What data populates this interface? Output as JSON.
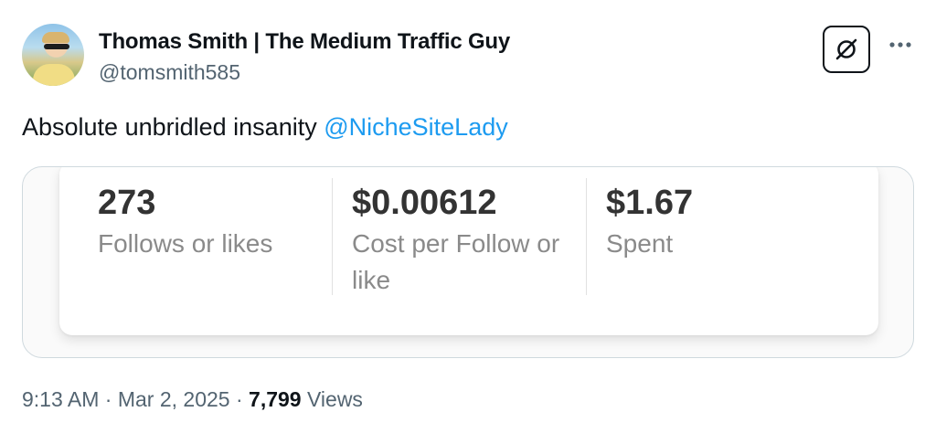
{
  "author": {
    "display_name": "Thomas Smith | The Medium Traffic Guy",
    "handle": "@tomsmith585",
    "avatar_icon": "profile-photo"
  },
  "actions": {
    "grok_icon": "grok-slash-icon",
    "more_icon": "more-dots-icon"
  },
  "tweet": {
    "text_before": "Absolute unbridled insanity ",
    "mention": "@NicheSiteLady"
  },
  "stats": [
    {
      "value": "273",
      "label": "Follows or likes"
    },
    {
      "value": "$0.00612",
      "label": "Cost per Follow or like"
    },
    {
      "value": "$1.67",
      "label": "Spent"
    }
  ],
  "meta": {
    "time": "9:13 AM",
    "separator_1": " · ",
    "date": "Mar 2, 2025",
    "separator_2": " · ",
    "views_count": "7,799",
    "views_label": " Views"
  },
  "colors": {
    "text_primary": "#0f1419",
    "text_secondary": "#536471",
    "link": "#1d9bf0",
    "border": "#cfd9de"
  }
}
